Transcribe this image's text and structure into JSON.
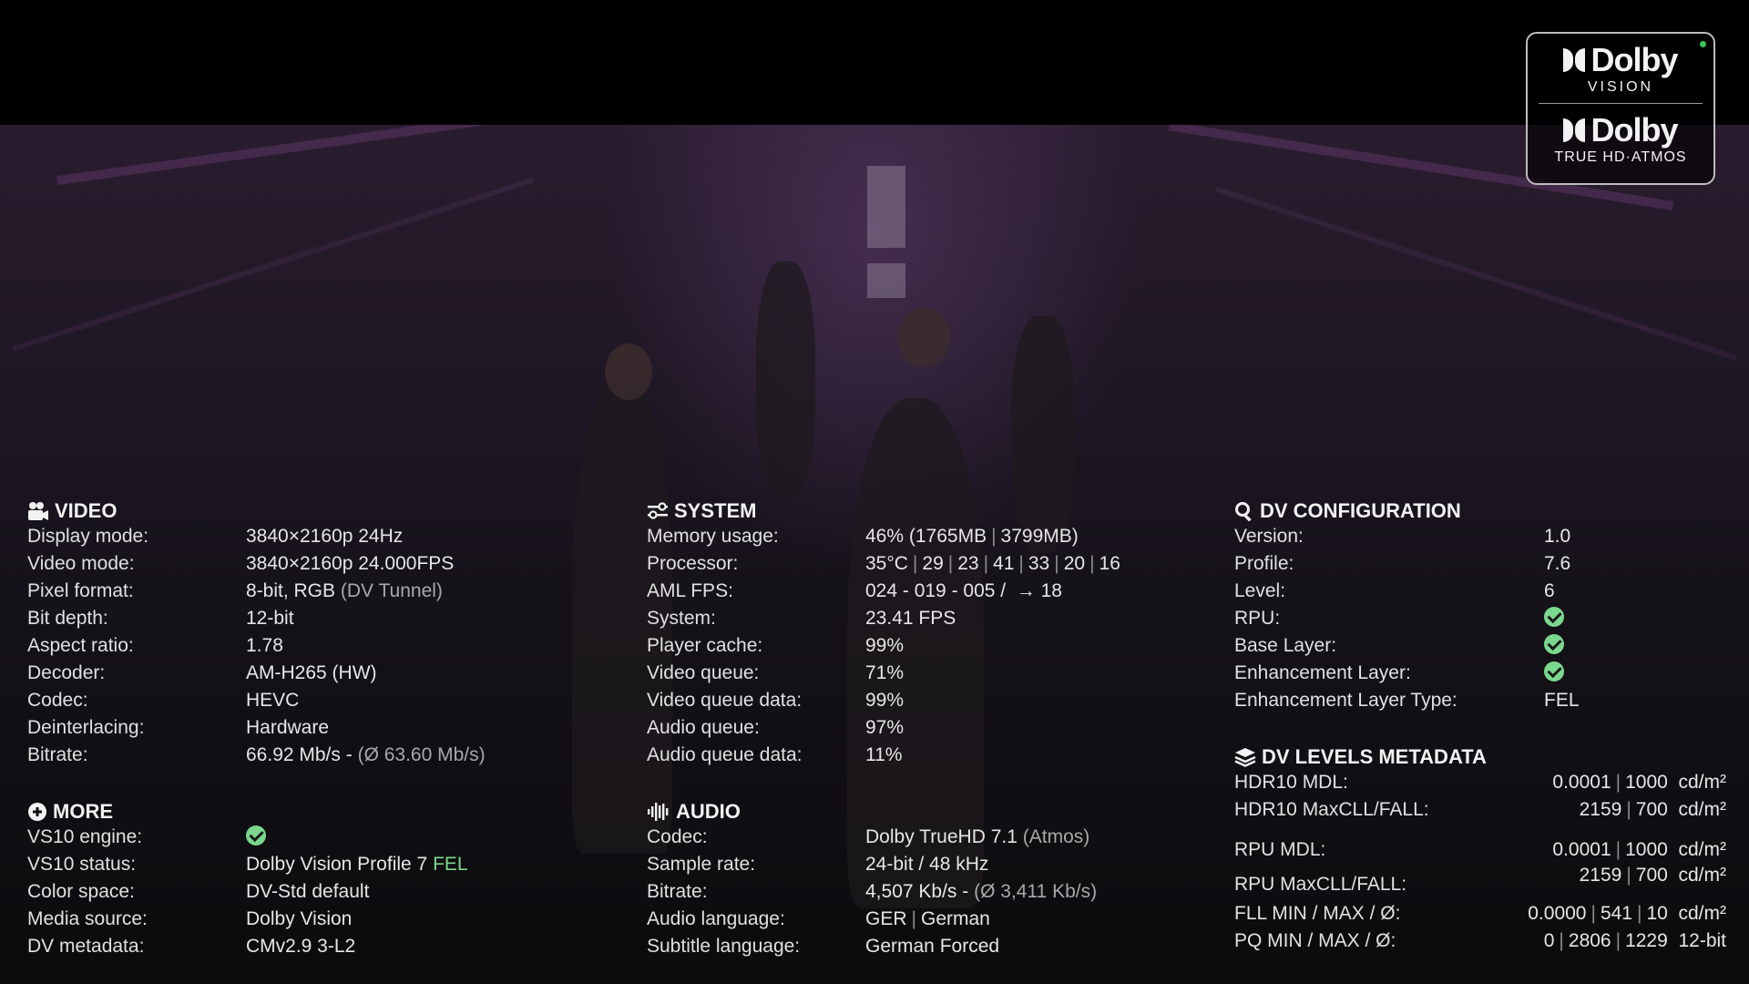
{
  "badge": {
    "vision_brand": "Dolby",
    "vision_sub": "VISION",
    "audio_brand": "Dolby",
    "audio_sub": "TRUE HD·ATMOS"
  },
  "video": {
    "title": "VIDEO",
    "rows": [
      {
        "k": "Display mode:",
        "v": "3840×2160p 24Hz"
      },
      {
        "k": "Video mode:",
        "v": "3840×2160p 24.000FPS"
      },
      {
        "k": "Pixel format:",
        "v": "8-bit, RGB",
        "extra": "(DV Tunnel)"
      },
      {
        "k": "Bit depth:",
        "v": "12-bit"
      },
      {
        "k": "Aspect ratio:",
        "v": "1.78"
      },
      {
        "k": "Decoder:",
        "v": "AM-H265 (HW)"
      },
      {
        "k": "Codec:",
        "v": "HEVC"
      },
      {
        "k": "Deinterlacing:",
        "v": "Hardware"
      },
      {
        "k": "Bitrate:",
        "v": "66.92 Mb/s -",
        "extra": "(Ø 63.60 Mb/s)"
      }
    ]
  },
  "more": {
    "title": "MORE",
    "rows": [
      {
        "k": "VS10 engine:"
      },
      {
        "k": "VS10 status:",
        "v": "Dolby Vision Profile 7",
        "extra": "FEL"
      },
      {
        "k": "Color space:",
        "v": "DV-Std default"
      },
      {
        "k": "Media source:",
        "v": "Dolby Vision"
      },
      {
        "k": "DV metadata:",
        "v": "CMv2.9 3-L2"
      }
    ]
  },
  "system": {
    "title": "SYSTEM",
    "memory": {
      "k": "Memory usage:",
      "a": "46% (1765MB",
      "b": "3799MB)"
    },
    "processor": {
      "k": "Processor:",
      "temp": "35°C",
      "cores": [
        "29",
        "23",
        "41",
        "33",
        "20",
        "16"
      ]
    },
    "aml": {
      "k": "AML FPS:",
      "v": "024 - 019 - 005 /",
      "arrow": "→",
      "n": "18"
    },
    "rows": [
      {
        "k": "System:",
        "v": "23.41 FPS"
      },
      {
        "k": "Player cache:",
        "v": "99%"
      },
      {
        "k": "Video queue:",
        "v": "71%"
      },
      {
        "k": "Video queue data:",
        "v": "99%"
      },
      {
        "k": "Audio queue:",
        "v": "97%"
      },
      {
        "k": "Audio queue data:",
        "v": "11%"
      }
    ]
  },
  "audio": {
    "title": "AUDIO",
    "rows": [
      {
        "k": "Codec:",
        "v": "Dolby TrueHD 7.1",
        "extra": "(Atmos)"
      },
      {
        "k": "Sample rate:",
        "v": "24-bit / 48 kHz"
      },
      {
        "k": "Bitrate:",
        "v": "4,507 Kb/s -",
        "extra": "(Ø 3,411 Kb/s)"
      },
      {
        "k": "Audio language:",
        "a": "GER",
        "b": "German"
      },
      {
        "k": "Subtitle language:",
        "v": "German Forced"
      }
    ]
  },
  "dvconfig": {
    "title": "DV CONFIGURATION",
    "rows": [
      {
        "k": "Version:",
        "v": "1.0"
      },
      {
        "k": "Profile:",
        "v": "7.6"
      },
      {
        "k": "Level:",
        "v": "6"
      },
      {
        "k": "RPU:"
      },
      {
        "k": "Base Layer:"
      },
      {
        "k": "Enhancement Layer:"
      },
      {
        "k": "Enhancement Layer Type:",
        "v": "FEL"
      }
    ]
  },
  "dvlevels": {
    "title": "DV LEVELS METADATA",
    "hdr10_mdl": {
      "k": "HDR10 MDL:",
      "a": "0.0001",
      "b": "1000",
      "u": "cd/m²"
    },
    "hdr10_maxcll": {
      "k": "HDR10 MaxCLL/FALL:",
      "a": "2159",
      "b": "700",
      "u": "cd/m²"
    },
    "rpu_mdl": {
      "k": "RPU MDL:",
      "a": "0.0001",
      "b": "1000",
      "u": "cd/m²"
    },
    "rpu_maxcll": {
      "k": "RPU MaxCLL/FALL:",
      "a": "2159",
      "b": "700",
      "u": "cd/m²"
    },
    "fll": {
      "k": "FLL MIN / MAX / Ø:",
      "a": "0.0000",
      "b": "541",
      "c": "10",
      "u": "cd/m²"
    },
    "pq": {
      "k": "PQ  MIN / MAX / Ø:",
      "a": "0",
      "b": "2806",
      "c": "1229",
      "u": "12-bit"
    }
  },
  "colors": {
    "accent_green": "#7bd88f",
    "badge_dot": "#39c35a"
  }
}
